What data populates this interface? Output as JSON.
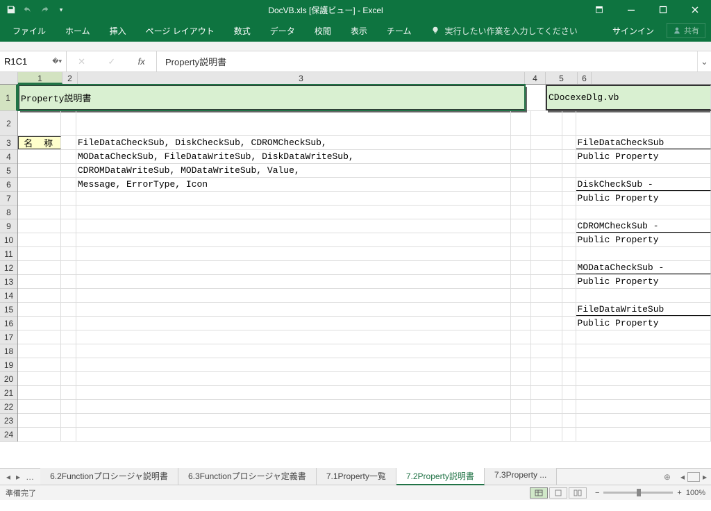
{
  "app": {
    "title": "DocVB.xls  [保護ビュー] - Excel",
    "signin": "サインイン",
    "share": "共有"
  },
  "ribbon": {
    "tabs": [
      "ファイル",
      "ホーム",
      "挿入",
      "ページ レイアウト",
      "数式",
      "データ",
      "校閲",
      "表示",
      "チーム"
    ],
    "tell_me": "実行したい作業を入力してください"
  },
  "formula_bar": {
    "name_box": "R1C1",
    "fx_label": "fx",
    "formula": "Property説明書"
  },
  "grid": {
    "col_labels": [
      "1",
      "2",
      "3",
      "4",
      "5",
      "6"
    ],
    "title_left": "Property説明書",
    "title_right": "CDocexeDlg.vb",
    "name_label": "名 称",
    "body_lines": [
      "FileDataCheckSub, DiskCheckSub, CDROMCheckSub,",
      "MODataCheckSub, FileDataWriteSub, DiskDataWriteSub,",
      "CDROMDataWriteSub, MODataWriteSub, Value,",
      "Message, ErrorType, Icon"
    ],
    "right_col": {
      "r3": "FileDataCheckSub",
      "r4": "Public Property",
      "r6": "DiskCheckSub - ",
      "r7": "Public Property",
      "r9": "CDROMCheckSub -",
      "r10": "Public Property",
      "r12": "MODataCheckSub -",
      "r13": "Public Property",
      "r15": "FileDataWriteSub",
      "r16": "Public Property"
    }
  },
  "sheets": {
    "tabs": [
      {
        "label": "6.2Functionプロシージャ説明書",
        "active": false
      },
      {
        "label": "6.3Functionプロシージャ定義書",
        "active": false
      },
      {
        "label": "7.1Property一覧",
        "active": false
      },
      {
        "label": "7.2Property説明書",
        "active": true
      },
      {
        "label": "7.3Property ...",
        "active": false
      }
    ]
  },
  "status": {
    "ready": "準備完了",
    "zoom": "100%"
  }
}
